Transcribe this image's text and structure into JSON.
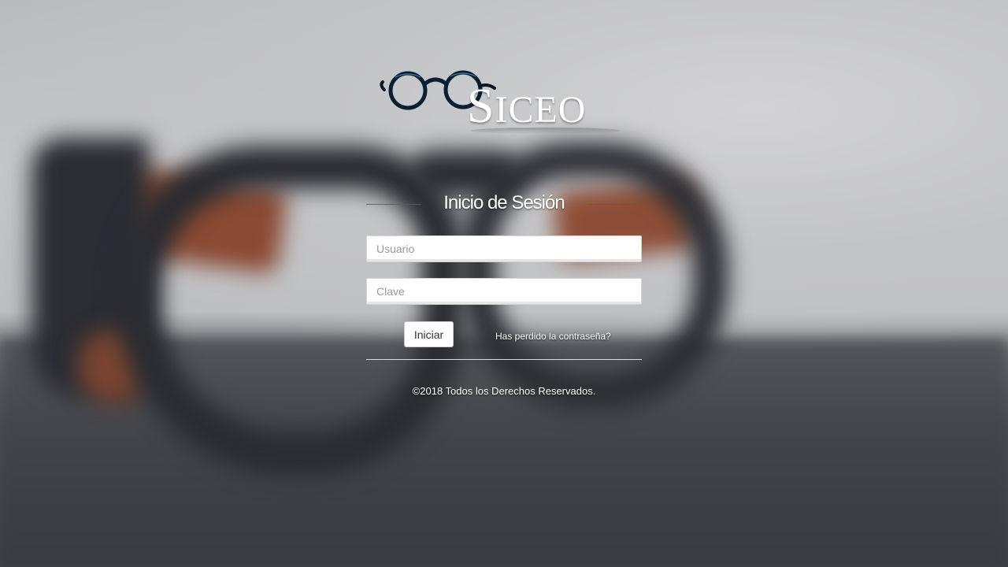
{
  "brand": {
    "logo_text_initial": "S",
    "logo_text_rest": "ICEO"
  },
  "login": {
    "title": "Inicio de Sesión",
    "username_placeholder": "Usuario",
    "password_placeholder": "Clave",
    "submit_label": "Iniciar",
    "forgot_link": "Has perdido la contraseña?"
  },
  "footer": {
    "copyright": "©2018 Todos los Derechos Reservados."
  },
  "icons": {
    "logo_icon": "eyeglasses-icon"
  },
  "colors": {
    "text_on_background": "#ffffff",
    "frame_dark": "#2a2c31",
    "frame_wood": "#8a4a33",
    "glasses_logo_blue": "#0f2a44"
  }
}
